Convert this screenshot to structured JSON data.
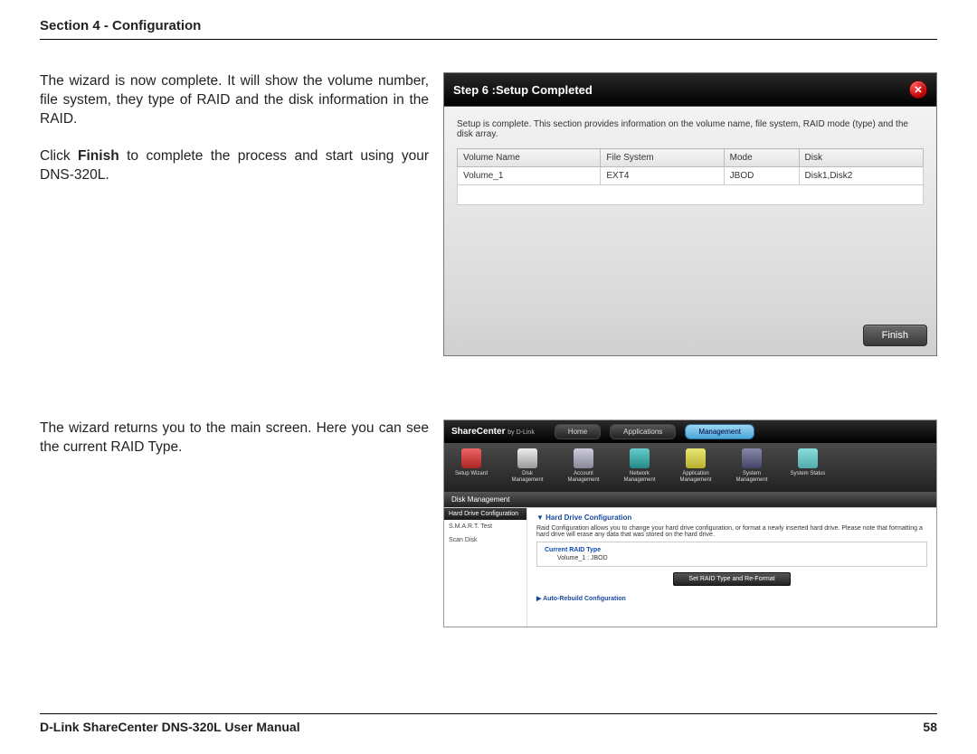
{
  "section_header": "Section 4 - Configuration",
  "para1": "The wizard is now complete. It will show the volume number, file system, they type of RAID and the disk information in the RAID.",
  "para2_pre": "Click ",
  "para2_bold": "Finish",
  "para2_post": " to complete the process and start using your DNS-320L.",
  "para3": "The wizard returns you to the main screen. Here you can see the current RAID Type.",
  "dialog1": {
    "step_title": "Step 6 :Setup Completed",
    "close_glyph": "✕",
    "description": "Setup is complete. This section provides information on the volume name, file system, RAID mode (type) and the disk array.",
    "headers": {
      "c1": "Volume Name",
      "c2": "File System",
      "c3": "Mode",
      "c4": "Disk"
    },
    "row1": {
      "c1": "Volume_1",
      "c2": "EXT4",
      "c3": "JBOD",
      "c4": "Disk1,Disk2"
    },
    "finish_label": "Finish"
  },
  "sc": {
    "logo_main": "ShareCenter",
    "logo_sub": "by D-Link",
    "tabs": {
      "home": "Home",
      "applications": "Applications",
      "management": "Management"
    },
    "icons": {
      "setup": "Setup Wizard",
      "disk": "Disk Management",
      "account": "Account Management",
      "network": "Network Management",
      "app": "Application Management",
      "system": "System Management",
      "status": "System Status"
    },
    "section_label": "Disk Management",
    "side": {
      "hd": "Hard Drive Configuration",
      "smart": "S.M.A.R.T. Test",
      "scan": "Scan Disk"
    },
    "main": {
      "title": "Hard Drive Configuration",
      "desc": "Raid Configuration allows you to change your hard drive configuration, or format a newly inserted hard drive. Please note that formatting a hard drive will erase any data that was stored on the hard drive.",
      "raid_label": "Current RAID Type",
      "raid_value": "Volume_1 : JBOD",
      "set_btn": "Set RAID Type and Re-Format",
      "collapse": "Auto-Rebuild Configuration"
    }
  },
  "footer": {
    "left": "D-Link ShareCenter DNS-320L User Manual",
    "right": "58"
  }
}
